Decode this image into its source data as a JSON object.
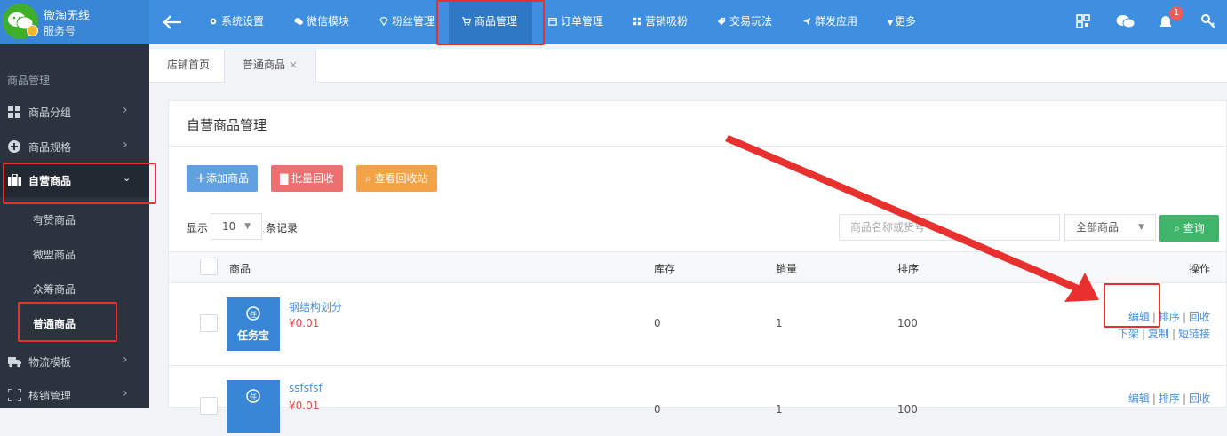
{
  "brand": {
    "name": "微淘无线",
    "sub": "服务号"
  },
  "nav": [
    {
      "label": "系统设置",
      "icon": "gear-icon"
    },
    {
      "label": "微信模块",
      "icon": "wechat-icon"
    },
    {
      "label": "粉丝管理",
      "icon": "diamond-icon"
    },
    {
      "label": "商品管理",
      "icon": "cart-icon",
      "active": true
    },
    {
      "label": "订单管理",
      "icon": "calendar-icon"
    },
    {
      "label": "营销吸粉",
      "icon": "grid-icon"
    },
    {
      "label": "交易玩法",
      "icon": "tag-icon"
    },
    {
      "label": "群发应用",
      "icon": "send-icon"
    },
    {
      "label": "更多",
      "icon": "caret-down-icon"
    }
  ],
  "notification_count": "1",
  "sidebar": {
    "heading": "商品管理",
    "items": [
      {
        "label": "商品分组",
        "icon": "grid-icon"
      },
      {
        "label": "商品规格",
        "icon": "plus-circle-icon"
      },
      {
        "label": "自营商品",
        "icon": "briefcase-icon"
      },
      {
        "label": "物流模板",
        "icon": "truck-icon"
      },
      {
        "label": "核销管理",
        "icon": "scan-icon"
      }
    ],
    "subitems": [
      "有赞商品",
      "微盟商品",
      "众筹商品",
      "普通商品"
    ]
  },
  "tabs": [
    {
      "label": "店铺首页"
    },
    {
      "label": "普通商品",
      "close": "×"
    }
  ],
  "panel": {
    "title": "自营商品管理",
    "add_button": "添加商品",
    "batch_recycle_button": "批量回收",
    "view_recycle_button": "查看回收站",
    "show_label": "显示",
    "page_size": "10",
    "records_label": "条记录",
    "search_placeholder": "商品名称或货号",
    "filter_value": "全部商品",
    "query_button": "查询"
  },
  "table": {
    "headers": {
      "product": "商品",
      "stock": "库存",
      "sales": "销量",
      "sort": "排序",
      "ops": "操作"
    },
    "rows": [
      {
        "name": "钢结构划分",
        "price": "¥0.01",
        "stock": "0",
        "sales": "1",
        "sort": "100",
        "thumb_text": "任务宝",
        "ops1": [
          "编辑",
          "排序",
          "回收"
        ],
        "ops2": [
          "下架",
          "复制",
          "短链接"
        ]
      },
      {
        "name": "ssfsfsf",
        "price": "¥0.01",
        "stock": "0",
        "sales": "1",
        "sort": "100",
        "thumb_text": "",
        "ops1": [
          "编辑",
          "排序",
          "回收"
        ],
        "ops2": []
      }
    ]
  },
  "colors": {
    "topbar": "#3f8fe0",
    "sidebar": "#2b333e",
    "highlight": "#e8312e",
    "link": "#4a90d9",
    "price": "#e04b4b"
  }
}
